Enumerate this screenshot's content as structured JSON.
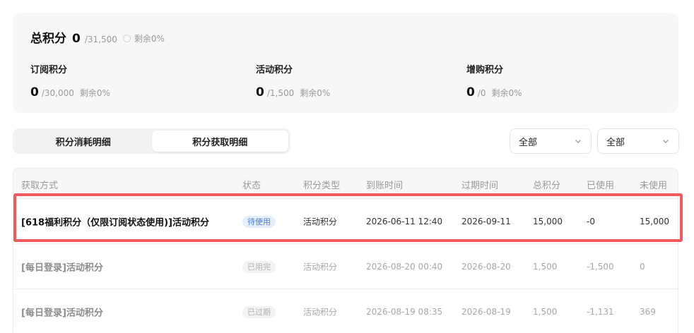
{
  "summary": {
    "total_label": "总积分",
    "total_value": "0",
    "total_max": "/31,500",
    "total_remain": "剩余0%",
    "categories": [
      {
        "label": "订阅积分",
        "value": "0",
        "max": "/30,000",
        "remain": "剩余0%"
      },
      {
        "label": "活动积分",
        "value": "0",
        "max": "/1,500",
        "remain": "剩余0%"
      },
      {
        "label": "增购积分",
        "value": "0",
        "max": "/0",
        "remain": "剩余0%"
      }
    ]
  },
  "tabs": [
    {
      "label": "积分消耗明细",
      "active": false
    },
    {
      "label": "积分获取明细",
      "active": true
    }
  ],
  "filters": [
    {
      "selected": "全部"
    },
    {
      "selected": "全部"
    }
  ],
  "table": {
    "headers": [
      "获取方式",
      "状态",
      "积分类型",
      "到账时间",
      "过期时间",
      "总积分",
      "已使用",
      "未使用"
    ],
    "rows": [
      {
        "name": "[618福利积分（仅限订阅状态使用)]活动积分",
        "status": "待使用",
        "type": "活动积分",
        "arrive": "2026-06-11 12:40",
        "expire": "2026-09-11",
        "total": "15,000",
        "used": "-0",
        "unused": "15,000"
      },
      {
        "name": "[每日登录]活动积分",
        "status": "已用完",
        "type": "活动积分",
        "arrive": "2026-08-20 00:40",
        "expire": "2026-08-20",
        "total": "1,500",
        "used": "-1,500",
        "unused": "0"
      },
      {
        "name": "[每日登录]活动积分",
        "status": "已过期",
        "type": "活动积分",
        "arrive": "2026-08-19 08:35",
        "expire": "2026-08-19",
        "total": "1,500",
        "used": "-1,131",
        "unused": "369"
      }
    ]
  },
  "colors": {
    "highlight": "#ef5b5b",
    "pending_badge_text": "#4b7fe0",
    "pending_badge_bg": "#e5effc"
  },
  "icons": {
    "remain_indicator": "progress-ring-icon",
    "select_arrow": "chevron-down-icon"
  }
}
